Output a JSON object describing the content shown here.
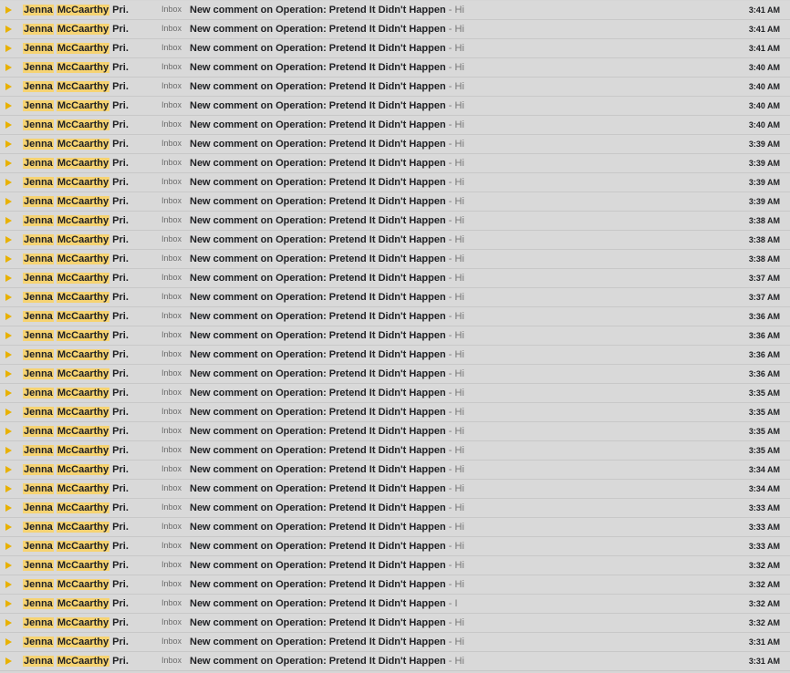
{
  "colors": {
    "marker": "#e8b100",
    "highlight": "#f6d372",
    "row_background": "#d9d9d9"
  },
  "icons": {
    "marker": "importance-marker-icon"
  },
  "emails": [
    {
      "sender_first": "Jenna",
      "sender_last": "McCaarthy",
      "sender_suffix": "Pri.",
      "label": "Inbox",
      "subject": "New comment on Operation: Pretend It Didn't Happen",
      "separator": "-",
      "snippet": "Hi",
      "time": "3:41 AM"
    },
    {
      "sender_first": "Jenna",
      "sender_last": "McCaarthy",
      "sender_suffix": "Pri.",
      "label": "Inbox",
      "subject": "New comment on Operation: Pretend It Didn't Happen",
      "separator": "-",
      "snippet": "Hi",
      "time": "3:41 AM"
    },
    {
      "sender_first": "Jenna",
      "sender_last": "McCaarthy",
      "sender_suffix": "Pri.",
      "label": "Inbox",
      "subject": "New comment on Operation: Pretend It Didn't Happen",
      "separator": "-",
      "snippet": "Hi",
      "time": "3:41 AM"
    },
    {
      "sender_first": "Jenna",
      "sender_last": "McCaarthy",
      "sender_suffix": "Pri.",
      "label": "Inbox",
      "subject": "New comment on Operation: Pretend It Didn't Happen",
      "separator": "-",
      "snippet": "Hi",
      "time": "3:40 AM"
    },
    {
      "sender_first": "Jenna",
      "sender_last": "McCaarthy",
      "sender_suffix": "Pri.",
      "label": "Inbox",
      "subject": "New comment on Operation: Pretend It Didn't Happen",
      "separator": "-",
      "snippet": "Hi",
      "time": "3:40 AM"
    },
    {
      "sender_first": "Jenna",
      "sender_last": "McCaarthy",
      "sender_suffix": "Pri.",
      "label": "Inbox",
      "subject": "New comment on Operation: Pretend It Didn't Happen",
      "separator": "-",
      "snippet": "Hi",
      "time": "3:40 AM"
    },
    {
      "sender_first": "Jenna",
      "sender_last": "McCaarthy",
      "sender_suffix": "Pri.",
      "label": "Inbox",
      "subject": "New comment on Operation: Pretend It Didn't Happen",
      "separator": "-",
      "snippet": "Hi",
      "time": "3:40 AM"
    },
    {
      "sender_first": "Jenna",
      "sender_last": "McCaarthy",
      "sender_suffix": "Pri.",
      "label": "Inbox",
      "subject": "New comment on Operation: Pretend It Didn't Happen",
      "separator": "-",
      "snippet": "Hi",
      "time": "3:39 AM"
    },
    {
      "sender_first": "Jenna",
      "sender_last": "McCaarthy",
      "sender_suffix": "Pri.",
      "label": "Inbox",
      "subject": "New comment on Operation: Pretend It Didn't Happen",
      "separator": "-",
      "snippet": "Hi",
      "time": "3:39 AM"
    },
    {
      "sender_first": "Jenna",
      "sender_last": "McCaarthy",
      "sender_suffix": "Pri.",
      "label": "Inbox",
      "subject": "New comment on Operation: Pretend It Didn't Happen",
      "separator": "-",
      "snippet": "Hi",
      "time": "3:39 AM"
    },
    {
      "sender_first": "Jenna",
      "sender_last": "McCaarthy",
      "sender_suffix": "Pri.",
      "label": "Inbox",
      "subject": "New comment on Operation: Pretend It Didn't Happen",
      "separator": "-",
      "snippet": "Hi",
      "time": "3:39 AM"
    },
    {
      "sender_first": "Jenna",
      "sender_last": "McCaarthy",
      "sender_suffix": "Pri.",
      "label": "Inbox",
      "subject": "New comment on Operation: Pretend It Didn't Happen",
      "separator": "-",
      "snippet": "Hi",
      "time": "3:38 AM"
    },
    {
      "sender_first": "Jenna",
      "sender_last": "McCaarthy",
      "sender_suffix": "Pri.",
      "label": "Inbox",
      "subject": "New comment on Operation: Pretend It Didn't Happen",
      "separator": "-",
      "snippet": "Hi",
      "time": "3:38 AM"
    },
    {
      "sender_first": "Jenna",
      "sender_last": "McCaarthy",
      "sender_suffix": "Pri.",
      "label": "Inbox",
      "subject": "New comment on Operation: Pretend It Didn't Happen",
      "separator": "-",
      "snippet": "Hi",
      "time": "3:38 AM"
    },
    {
      "sender_first": "Jenna",
      "sender_last": "McCaarthy",
      "sender_suffix": "Pri.",
      "label": "Inbox",
      "subject": "New comment on Operation: Pretend It Didn't Happen",
      "separator": "-",
      "snippet": "Hi",
      "time": "3:37 AM"
    },
    {
      "sender_first": "Jenna",
      "sender_last": "McCaarthy",
      "sender_suffix": "Pri.",
      "label": "Inbox",
      "subject": "New comment on Operation: Pretend It Didn't Happen",
      "separator": "-",
      "snippet": "Hi",
      "time": "3:37 AM"
    },
    {
      "sender_first": "Jenna",
      "sender_last": "McCaarthy",
      "sender_suffix": "Pri.",
      "label": "Inbox",
      "subject": "New comment on Operation: Pretend It Didn't Happen",
      "separator": "-",
      "snippet": "Hi",
      "time": "3:36 AM"
    },
    {
      "sender_first": "Jenna",
      "sender_last": "McCaarthy",
      "sender_suffix": "Pri.",
      "label": "Inbox",
      "subject": "New comment on Operation: Pretend It Didn't Happen",
      "separator": "-",
      "snippet": "Hi",
      "time": "3:36 AM"
    },
    {
      "sender_first": "Jenna",
      "sender_last": "McCaarthy",
      "sender_suffix": "Pri.",
      "label": "Inbox",
      "subject": "New comment on Operation: Pretend It Didn't Happen",
      "separator": "-",
      "snippet": "Hi",
      "time": "3:36 AM"
    },
    {
      "sender_first": "Jenna",
      "sender_last": "McCaarthy",
      "sender_suffix": "Pri.",
      "label": "Inbox",
      "subject": "New comment on Operation: Pretend It Didn't Happen",
      "separator": "-",
      "snippet": "Hi",
      "time": "3:36 AM"
    },
    {
      "sender_first": "Jenna",
      "sender_last": "McCaarthy",
      "sender_suffix": "Pri.",
      "label": "Inbox",
      "subject": "New comment on Operation: Pretend It Didn't Happen",
      "separator": "-",
      "snippet": "Hi",
      "time": "3:35 AM"
    },
    {
      "sender_first": "Jenna",
      "sender_last": "McCaarthy",
      "sender_suffix": "Pri.",
      "label": "Inbox",
      "subject": "New comment on Operation: Pretend It Didn't Happen",
      "separator": "-",
      "snippet": "Hi",
      "time": "3:35 AM"
    },
    {
      "sender_first": "Jenna",
      "sender_last": "McCaarthy",
      "sender_suffix": "Pri.",
      "label": "Inbox",
      "subject": "New comment on Operation: Pretend It Didn't Happen",
      "separator": "-",
      "snippet": "Hi",
      "time": "3:35 AM"
    },
    {
      "sender_first": "Jenna",
      "sender_last": "McCaarthy",
      "sender_suffix": "Pri.",
      "label": "Inbox",
      "subject": "New comment on Operation: Pretend It Didn't Happen",
      "separator": "-",
      "snippet": "Hi",
      "time": "3:35 AM"
    },
    {
      "sender_first": "Jenna",
      "sender_last": "McCaarthy",
      "sender_suffix": "Pri.",
      "label": "Inbox",
      "subject": "New comment on Operation: Pretend It Didn't Happen",
      "separator": "-",
      "snippet": "Hi",
      "time": "3:34 AM"
    },
    {
      "sender_first": "Jenna",
      "sender_last": "McCaarthy",
      "sender_suffix": "Pri.",
      "label": "Inbox",
      "subject": "New comment on Operation: Pretend It Didn't Happen",
      "separator": "-",
      "snippet": "Hi",
      "time": "3:34 AM"
    },
    {
      "sender_first": "Jenna",
      "sender_last": "McCaarthy",
      "sender_suffix": "Pri.",
      "label": "Inbox",
      "subject": "New comment on Operation: Pretend It Didn't Happen",
      "separator": "-",
      "snippet": "Hi",
      "time": "3:33 AM"
    },
    {
      "sender_first": "Jenna",
      "sender_last": "McCaarthy",
      "sender_suffix": "Pri.",
      "label": "Inbox",
      "subject": "New comment on Operation: Pretend It Didn't Happen",
      "separator": "-",
      "snippet": "Hi",
      "time": "3:33 AM"
    },
    {
      "sender_first": "Jenna",
      "sender_last": "McCaarthy",
      "sender_suffix": "Pri.",
      "label": "Inbox",
      "subject": "New comment on Operation: Pretend It Didn't Happen",
      "separator": "-",
      "snippet": "Hi",
      "time": "3:33 AM"
    },
    {
      "sender_first": "Jenna",
      "sender_last": "McCaarthy",
      "sender_suffix": "Pri.",
      "label": "Inbox",
      "subject": "New comment on Operation: Pretend It Didn't Happen",
      "separator": "-",
      "snippet": "Hi",
      "time": "3:32 AM"
    },
    {
      "sender_first": "Jenna",
      "sender_last": "McCaarthy",
      "sender_suffix": "Pri.",
      "label": "Inbox",
      "subject": "New comment on Operation: Pretend It Didn't Happen",
      "separator": "-",
      "snippet": "Hi",
      "time": "3:32 AM"
    },
    {
      "sender_first": "Jenna",
      "sender_last": "McCaarthy",
      "sender_suffix": "Pri.",
      "label": "Inbox",
      "subject": "New comment on Operation: Pretend It Didn't Happen",
      "separator": "-",
      "snippet": "I",
      "time": "3:32 AM"
    },
    {
      "sender_first": "Jenna",
      "sender_last": "McCaarthy",
      "sender_suffix": "Pri.",
      "label": "Inbox",
      "subject": "New comment on Operation: Pretend It Didn't Happen",
      "separator": "-",
      "snippet": "Hi",
      "time": "3:32 AM"
    },
    {
      "sender_first": "Jenna",
      "sender_last": "McCaarthy",
      "sender_suffix": "Pri.",
      "label": "Inbox",
      "subject": "New comment on Operation: Pretend It Didn't Happen",
      "separator": "-",
      "snippet": "Hi",
      "time": "3:31 AM"
    },
    {
      "sender_first": "Jenna",
      "sender_last": "McCaarthy",
      "sender_suffix": "Pri.",
      "label": "Inbox",
      "subject": "New comment on Operation: Pretend It Didn't Happen",
      "separator": "-",
      "snippet": "Hi",
      "time": "3:31 AM"
    }
  ]
}
